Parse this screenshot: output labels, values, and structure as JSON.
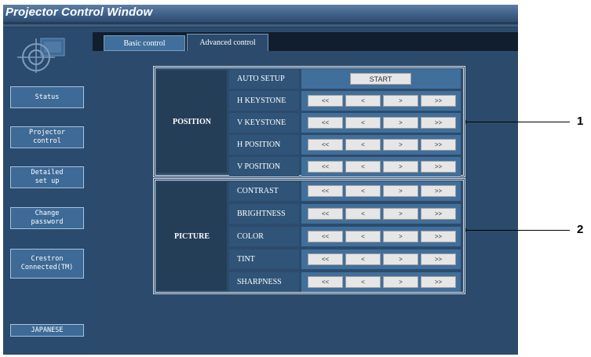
{
  "window": {
    "title": "Projector Control Window"
  },
  "sidebar": {
    "items": [
      {
        "label": "Status"
      },
      {
        "label": "Projector\ncontrol"
      },
      {
        "label": "Detailed\nset up"
      },
      {
        "label": "Change\npassword"
      },
      {
        "label": "Crestron\nConnected(TM)"
      }
    ],
    "language_button": "JAPANESE"
  },
  "tabs": [
    {
      "label": "Basic control",
      "active": false
    },
    {
      "label": "Advanced control",
      "active": true
    }
  ],
  "position_group": {
    "label": "POSITION",
    "auto_setup": {
      "label": "AUTO SETUP",
      "button": "START"
    },
    "rows": [
      {
        "label": "H KEYSTONE"
      },
      {
        "label": "V KEYSTONE"
      },
      {
        "label": "H POSITION"
      },
      {
        "label": "V POSITION"
      }
    ]
  },
  "picture_group": {
    "label": "PICTURE",
    "rows": [
      {
        "label": "CONTRAST"
      },
      {
        "label": "BRIGHTNESS"
      },
      {
        "label": "COLOR"
      },
      {
        "label": "TINT"
      },
      {
        "label": "SHARPNESS"
      }
    ]
  },
  "adjust_buttons": [
    "<<",
    "<",
    ">",
    ">>"
  ],
  "callouts": [
    "1",
    "2"
  ],
  "colors": {
    "window_bg": "#243e58",
    "content_bg": "#2c4b6c",
    "label_cell": "#2f5477",
    "control_cell": "#416f9b",
    "button_face": "#e6e6e6"
  }
}
